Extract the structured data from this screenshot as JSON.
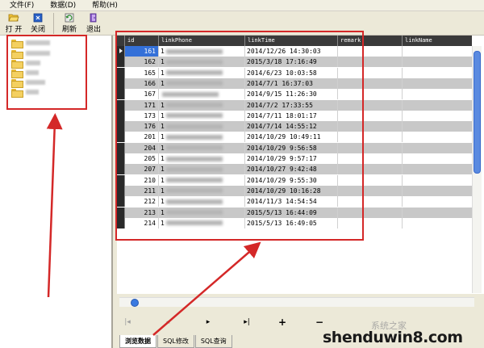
{
  "menu": {
    "items": [
      "文件(F)",
      "数据(D)",
      "帮助(H)"
    ]
  },
  "toolbar": {
    "open": "打 开",
    "close": "关闭",
    "refresh": "刷新",
    "exit": "退出"
  },
  "grid": {
    "columns": [
      "id",
      "linkPhone",
      "linkTime",
      "remark",
      "linkName"
    ],
    "rows": [
      {
        "id": "161",
        "phone": "1",
        "time": "2014/12/26 14:30:03"
      },
      {
        "id": "162",
        "phone": "1",
        "time": "2015/3/18 17:16:49"
      },
      {
        "id": "165",
        "phone": "1",
        "time": "2014/6/23 10:03:58"
      },
      {
        "id": "166",
        "phone": "1",
        "time": "2014/7/1 16:37:03"
      },
      {
        "id": "167",
        "phone": "",
        "time": "2014/9/15 11:26:30"
      },
      {
        "id": "171",
        "phone": "1",
        "time": "2014/7/2 17:33:55"
      },
      {
        "id": "173",
        "phone": "1",
        "time": "2014/7/11 18:01:17"
      },
      {
        "id": "176",
        "phone": "1",
        "time": "2014/7/14 14:55:12"
      },
      {
        "id": "201",
        "phone": "1",
        "time": "2014/10/29 10:49:11"
      },
      {
        "id": "204",
        "phone": "1",
        "time": "2014/10/29 9:56:58"
      },
      {
        "id": "205",
        "phone": "1",
        "time": "2014/10/29 9:57:17"
      },
      {
        "id": "207",
        "phone": "1",
        "time": "2014/10/27 9:42:48"
      },
      {
        "id": "210",
        "phone": "1",
        "time": "2014/10/29 9:55:30"
      },
      {
        "id": "211",
        "phone": "1",
        "time": "2014/10/29 10:16:28"
      },
      {
        "id": "212",
        "phone": "1",
        "time": "2014/11/3 14:54:54"
      },
      {
        "id": "213",
        "phone": "1",
        "time": "2015/5/13 16:44:09"
      },
      {
        "id": "214",
        "phone": "1",
        "time": "2015/5/13 16:49:05"
      }
    ]
  },
  "navigator": {
    "first": "|◂",
    "prev": "◂",
    "next": "▸",
    "last": "▸|",
    "add": "+",
    "delete": "−"
  },
  "tabs": [
    "浏览数据",
    "SQL修改",
    "SQL查询"
  ],
  "watermark": {
    "small": "系统之家",
    "main": "shenduwin8.com"
  },
  "colors": {
    "annotation": "#d42828",
    "selection": "#3470d8",
    "alt_row": "#c8c8c8"
  }
}
